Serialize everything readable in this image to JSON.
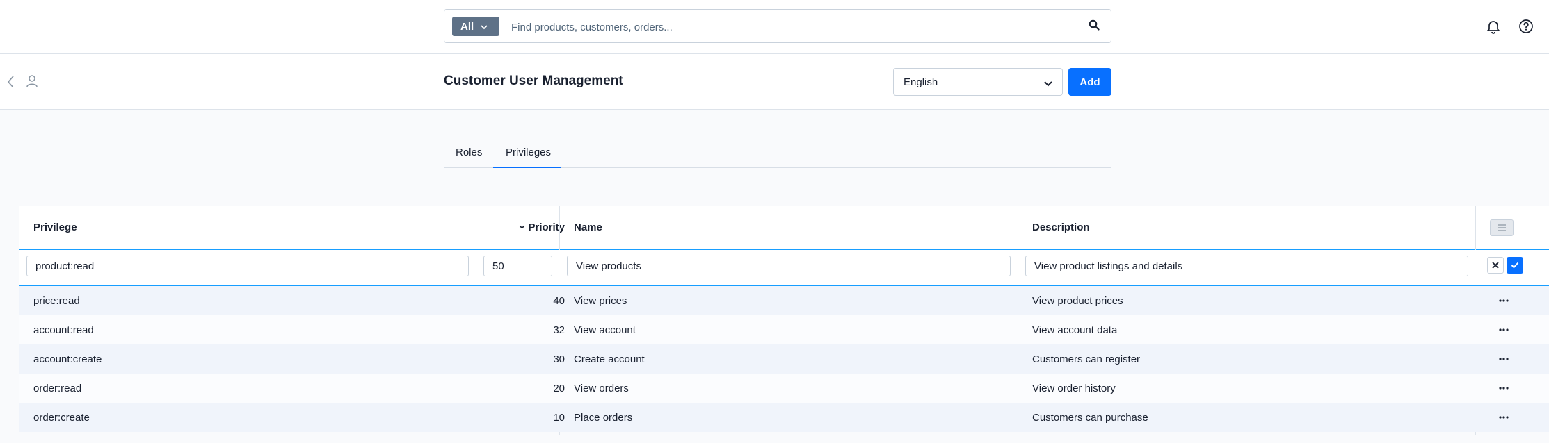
{
  "search": {
    "scope_label": "All",
    "placeholder": "Find products, customers, orders..."
  },
  "header": {
    "title": "Customer User Management",
    "language": "English",
    "add_label": "Add"
  },
  "tabs": [
    {
      "label": "Roles",
      "active": false
    },
    {
      "label": "Privileges",
      "active": true
    }
  ],
  "table": {
    "columns": {
      "privilege": "Privilege",
      "priority": "Priority",
      "name": "Name",
      "description": "Description"
    },
    "sort": {
      "column": "priority",
      "direction": "descending"
    },
    "edit_row": {
      "privilege": "product:read",
      "priority": "50",
      "name": "View products",
      "description": "View product listings and details"
    },
    "rows": [
      {
        "privilege": "price:read",
        "priority": "40",
        "name": "View prices",
        "description": "View product prices"
      },
      {
        "privilege": "account:read",
        "priority": "32",
        "name": "View account",
        "description": "View account data"
      },
      {
        "privilege": "account:create",
        "priority": "30",
        "name": "Create account",
        "description": "Customers can register"
      },
      {
        "privilege": "order:read",
        "priority": "20",
        "name": "View orders",
        "description": "View order history"
      },
      {
        "privilege": "order:create",
        "priority": "10",
        "name": "Place orders",
        "description": "Customers can purchase"
      }
    ]
  },
  "colors": {
    "accent": "#0870ff",
    "scope_button": "#5e7187",
    "row_highlight": "#f0f4fb"
  }
}
